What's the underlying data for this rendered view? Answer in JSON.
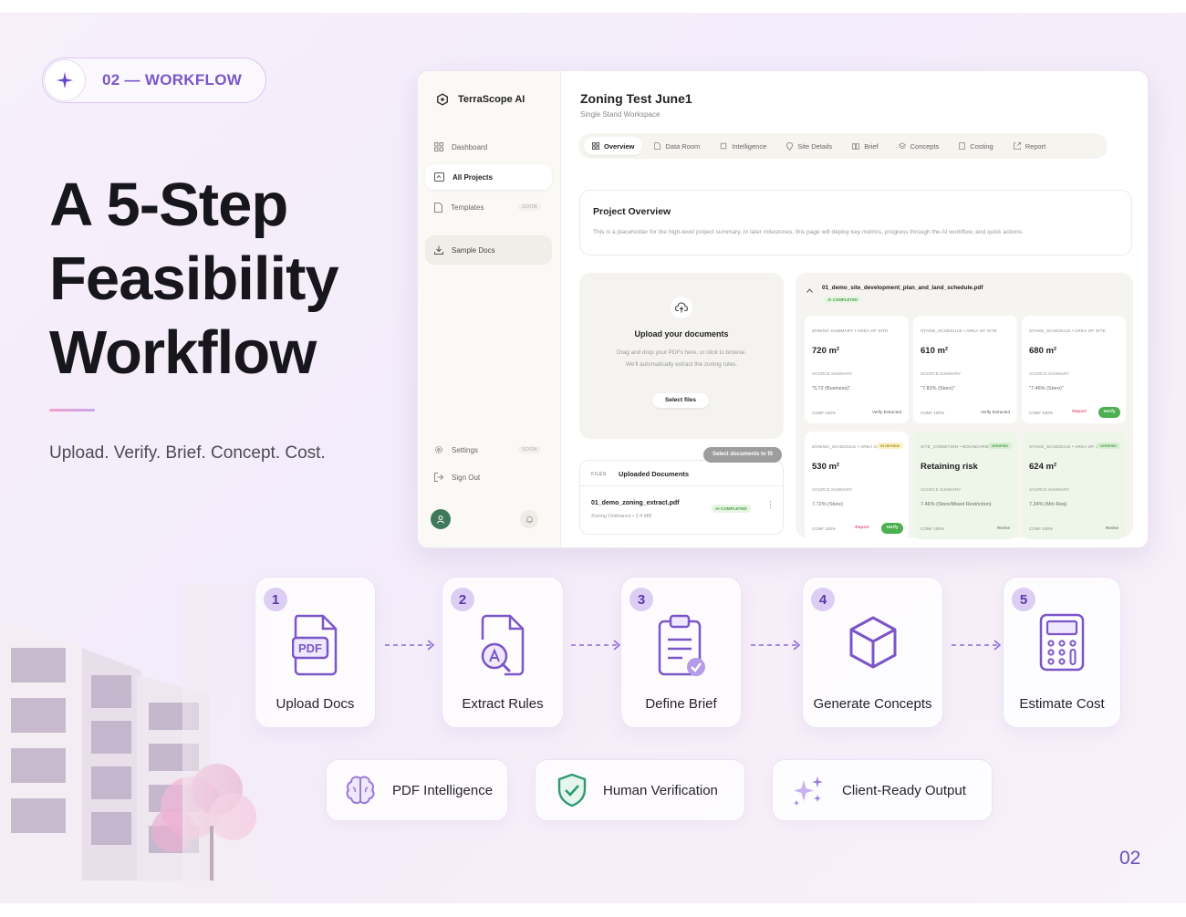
{
  "badge": {
    "label": "02 — WORKFLOW"
  },
  "headline": [
    "A 5-Step",
    "Feasibility",
    "Workflow"
  ],
  "tagline": "Upload. Verify. Brief. Concept. Cost.",
  "app": {
    "brand": "TerraScope AI",
    "sidebar": [
      {
        "label": "Dashboard",
        "icon": "grid-icon",
        "soon": ""
      },
      {
        "label": "All Projects",
        "icon": "folder-icon",
        "soon": ""
      },
      {
        "label": "Templates",
        "icon": "file-icon",
        "soon": "SOON"
      },
      {
        "label": "Sample Docs",
        "icon": "download-icon",
        "soon": ""
      }
    ],
    "sidebar_bottom": [
      {
        "label": "Settings",
        "icon": "gear-icon",
        "soon": "SOON"
      },
      {
        "label": "Sign Out",
        "icon": "signout-icon",
        "soon": ""
      }
    ],
    "project_title": "Zoning Test June1",
    "workspace": "Single Stand Workspace",
    "tabs": [
      "Overview",
      "Data Room",
      "Intelligence",
      "Site Details",
      "Brief",
      "Concepts",
      "Costing",
      "Report"
    ],
    "overview": {
      "title": "Project Overview",
      "text": "This is a placeholder  for  the high-level project summary. In later milestones, this page will deploy key metrics, progress through the AI workflow, and quick actions."
    },
    "upload": {
      "title": "Upload your documents",
      "line1": "Drag and drop your PDFs here, or click to browse.",
      "line2": "We'll automatically extract the zoning rules.",
      "button": "Select files"
    },
    "select_pill": "Select documents to fit",
    "files": {
      "tag": "FILES",
      "title": "Uploaded Documents",
      "file_name": "01_demo_zoning_extract.pdf",
      "file_meta": "Zoning Ordinance • 2.4 MB",
      "status": "AI COMPLETED"
    },
    "results": {
      "file_name": "01_demo_site_development_plan_and_land_schedule.pdf",
      "status": "AI COMPLETED",
      "cells": [
        {
          "cap": "ZONING SUMMARY • AREA OF SITE",
          "val": "720 m²",
          "src": "SOURCE SUMMARY",
          "qt": "\"5.72 (Business)\"",
          "cf": "CONF 100%",
          "act": "Verify Extracted",
          "tag": "",
          "green": false,
          "btns": []
        },
        {
          "cap": "STAND_SCHEDULE • AREA OF SITE",
          "val": "610 m²",
          "src": "SOURCE SUMMARY",
          "qt": "\"7.82% (Store)\"",
          "cf": "CONF 100%",
          "act": "Verify Extracted",
          "tag": "",
          "green": false,
          "btns": []
        },
        {
          "cap": "STAND_SCHEDULE • AREA OF SITE",
          "val": "680 m²",
          "src": "SOURCE SUMMARY",
          "qt": "\"7.46% (Store)\"",
          "cf": "CONF 100%",
          "act": "",
          "tag": "",
          "green": false,
          "btns": [
            "Report",
            "Verify"
          ]
        },
        {
          "cap": "ZONING_SCHEDULE • AREA OF SITE",
          "val": "530 m²",
          "src": "SOURCE SUMMARY",
          "qt": "7.72% (Store)",
          "cf": "CONF 100%",
          "act": "",
          "tag": "IN REVIEW",
          "green": false,
          "btns": [
            "Report",
            "Verify"
          ]
        },
        {
          "cap": "SITE_CONDITION • BOUNDARIES",
          "val": "Retaining risk",
          "src": "SOURCE SUMMARY",
          "qt": "7.46% (Store/Mixed Restriction)",
          "cf": "CONF 100%",
          "act": "Revise",
          "tag": "VERIFIED",
          "green": true,
          "btns": []
        },
        {
          "cap": "STAND_SCHEDULE • AREA OF SITE",
          "val": "624 m²",
          "src": "SOURCE SUMMARY",
          "qt": "7.24% (Min Req)",
          "cf": "CONF 100%",
          "act": "Revise",
          "tag": "VERIFIED",
          "green": true,
          "btns": []
        }
      ]
    }
  },
  "steps": [
    {
      "n": "1",
      "label": "Upload Docs",
      "icon": "pdf-file-icon"
    },
    {
      "n": "2",
      "label": "Extract Rules",
      "icon": "document-search-icon"
    },
    {
      "n": "3",
      "label": "Define Brief",
      "icon": "clipboard-check-icon"
    },
    {
      "n": "4",
      "label": "Generate Concepts",
      "icon": "cube-icon"
    },
    {
      "n": "5",
      "label": "Estimate Cost",
      "icon": "calculator-icon"
    }
  ],
  "pdf_label": "PDF",
  "features": [
    {
      "label": "PDF Intelligence",
      "icon": "brain-icon"
    },
    {
      "label": "Human Verification",
      "icon": "shield-check-icon"
    },
    {
      "label": "Client-Ready Output",
      "icon": "sparkles-icon"
    }
  ],
  "page_number": "02",
  "colors": {
    "accent": "#7b56c9",
    "accent_light": "#dccdf5",
    "verified": "#4caf50",
    "report": "#e85a7a"
  }
}
